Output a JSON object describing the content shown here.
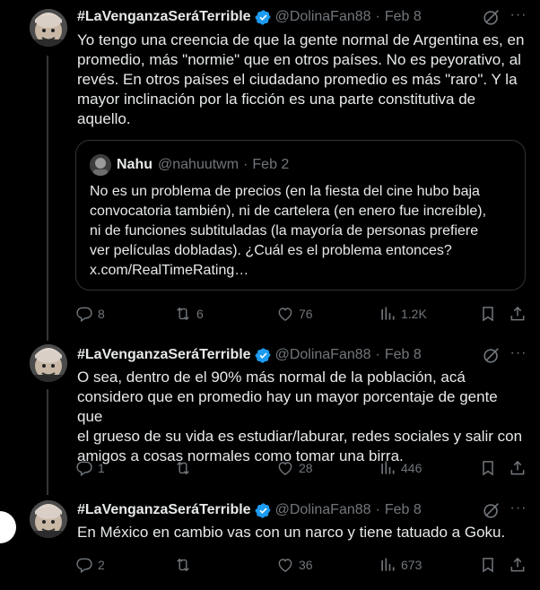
{
  "colors": {
    "background": "#000000",
    "text": "#e7e9ea",
    "muted": "#71767b",
    "verified": "#1d9bf0",
    "border": "#2f3336"
  },
  "tweets": [
    {
      "name": "#LaVenganzaSeráTerrible",
      "handle": "@DolinaFan88",
      "date": "Feb 8",
      "text": "Yo tengo una creencia de que la gente normal de Argentina es, en\npromedio, más \"normie\" que en otros países. No es peyorativo, al\nrevés. En otros países el ciudadano promedio es más \"raro\". Y la\nmayor inclinación por la ficción es una parte constitutiva de\naquello.",
      "quote": {
        "name": "Nahu",
        "handle": "@nahuutwm",
        "date": "Feb 2",
        "text": "No es un problema de precios (en la fiesta del cine hubo baja\nconvocatoria también), ni de cartelera (en enero fue increíble),\nni de funciones subtituladas (la mayoría de personas prefiere\nver películas dobladas). ¿Cuál es el problema entonces?\nx.com/RealTimeRating…"
      },
      "replies": "8",
      "reposts": "6",
      "likes": "76",
      "views": "1.2K"
    },
    {
      "name": "#LaVenganzaSeráTerrible",
      "handle": "@DolinaFan88",
      "date": "Feb 8",
      "text": "O sea, dentro de el 90% más normal de la población, acá\nconsidero que en promedio hay un mayor porcentaje de gente que\nel grueso de su vida es estudiar/laburar, redes sociales y salir con\namigos a cosas normales como tomar una birra.",
      "replies": "1",
      "reposts": "",
      "likes": "28",
      "views": "446"
    },
    {
      "name": "#LaVenganzaSeráTerrible",
      "handle": "@DolinaFan88",
      "date": "Feb 8",
      "text": "En México en cambio vas con un narco y tiene tatuado a Goku.",
      "replies": "2",
      "reposts": "",
      "likes": "36",
      "views": "673"
    }
  ],
  "icons": {
    "reply": "reply-icon",
    "repost": "repost-icon",
    "like": "heart-icon",
    "views": "views-icon",
    "bookmark": "bookmark-icon",
    "share": "share-icon",
    "grok": "grok-icon",
    "more": "more-icon",
    "verified": "verified-badge-icon"
  }
}
